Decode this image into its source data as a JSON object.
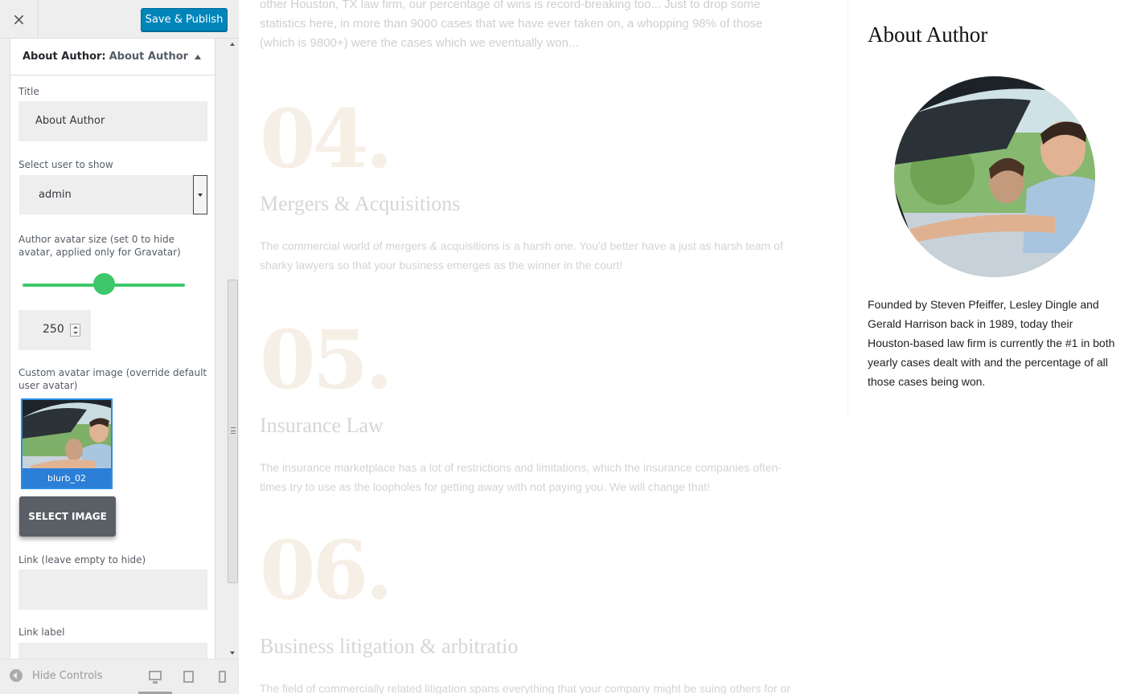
{
  "toolbar": {
    "close_glyph": "×",
    "save_label": "Save & Publish"
  },
  "panel": {
    "header_title": "About Author:",
    "header_subtitle": "About Author",
    "title_label": "Title",
    "title_value": "About Author",
    "user_label": "Select user to show",
    "user_value": "admin",
    "avatar_size_label": "Author avatar size (set 0 to hide avatar, applied only for Gravatar)",
    "avatar_size_slider_fraction": 0.5,
    "avatar_size_value": "250",
    "custom_avatar_label": "Custom avatar image (override default user avatar)",
    "thumb_caption": "blurb_02",
    "select_image_label": "SELECT IMAGE",
    "link_label": "Link (leave empty to hide)",
    "link_value": "",
    "link_label_label": "Link label"
  },
  "footer": {
    "hide_controls_label": "Hide Controls"
  },
  "preview": {
    "intro_text": "other Houston, TX law firm, our percentage of wins is record-breaking too... Just to drop some statistics here, in more than 9000 cases that we have ever taken on, a whopping 98% of those (which is 9800+) were the cases which we eventually won...",
    "sections": [
      {
        "num": "04.",
        "title": "Mergers & Acquisitions",
        "text": "The commercial world of mergers & acquisitions is a harsh one. You'd better have a just as harsh team of sharky lawyers so that your business emerges as the winner in the court!"
      },
      {
        "num": "05.",
        "title": "Insurance Law",
        "text": "The insurance marketplace has a lot of restrictions and limitations, which the insurance companies often-times try to use as the loopholes for getting away with not paying you. We will change that!"
      },
      {
        "num": "06.",
        "title": "Business litigation & arbitratio",
        "text": "The field of commercially related litigation spans everything that your company might be suing others for or"
      }
    ],
    "widget": {
      "title": "About Author",
      "bio": "Founded by Steven Pfeiffer, Lesley Dingle and Gerald Harrison back in 1989, today their Houston-based law firm is currently the #1 in both yearly cases dealt with and the percentage of all those cases being won."
    }
  },
  "colors": {
    "accent": "#0085ba",
    "slider": "#3ec76a",
    "thumb_border": "#2a8ee8"
  },
  "icons": [
    "close-icon",
    "collapse-arrow-icon",
    "select-arrow-icon",
    "spinner-icon",
    "hide-controls-icon",
    "desktop-icon",
    "tablet-icon",
    "mobile-icon"
  ]
}
